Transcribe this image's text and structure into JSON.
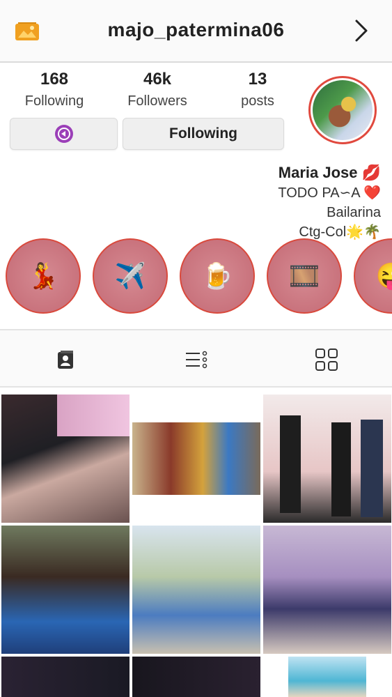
{
  "header": {
    "username": "majo_patermina06",
    "icons": [
      "gallery-icon",
      "chevron-right-icon"
    ]
  },
  "stats": {
    "posts": {
      "value": "13",
      "label": "posts"
    },
    "followers": {
      "value": "46k",
      "label": "Followers"
    },
    "following": {
      "value": "168",
      "label": "Following"
    }
  },
  "buttons": {
    "follow_label": "Following",
    "share_icon": "share-icon"
  },
  "bio": {
    "name": "Maria Jose 💋",
    "line1": "TODO PA∽A ❤️",
    "line2": "Bailarina",
    "line3": "Ctg-Col🌟🌴"
  },
  "highlights": [
    {
      "icon": "💃"
    },
    {
      "icon": "✈️"
    },
    {
      "icon": "🍺"
    },
    {
      "icon": "🎞️"
    },
    {
      "icon": "😜"
    }
  ],
  "tabs": [
    "tagged-icon",
    "list-icon",
    "grid-icon"
  ],
  "colors": {
    "accent_ring": "#e0493e",
    "highlight_fill": "#c9737d",
    "button_bg": "#efefef",
    "share_icon": "#9b3fb8"
  }
}
